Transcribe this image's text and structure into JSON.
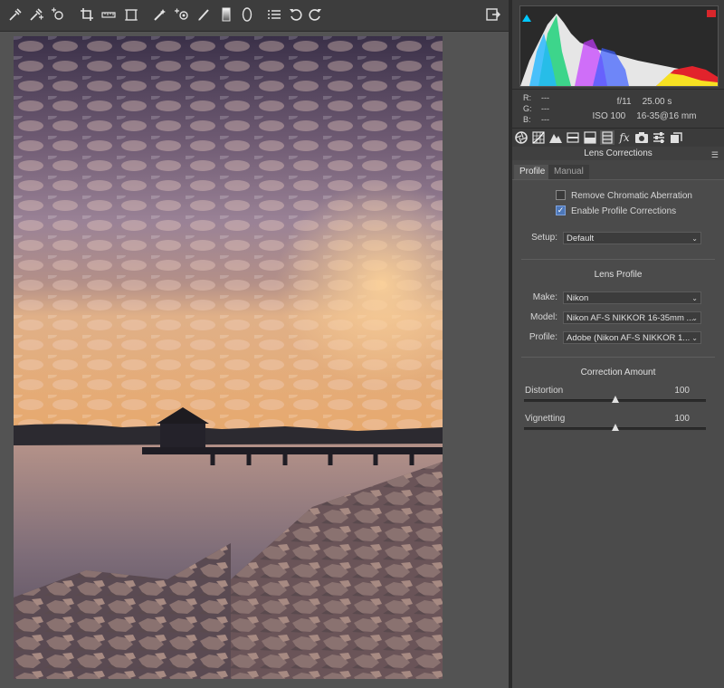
{
  "toolbar": {
    "tools": [
      {
        "icon": "white-balance-eyedropper-icon"
      },
      {
        "icon": "color-sampler-icon"
      },
      {
        "icon": "targeted-adjustment-icon"
      },
      {
        "icon": "crop-icon"
      },
      {
        "icon": "straighten-icon"
      },
      {
        "icon": "transform-icon"
      },
      {
        "icon": "spot-removal-icon"
      },
      {
        "icon": "red-eye-icon"
      },
      {
        "icon": "adjustment-brush-icon"
      },
      {
        "icon": "graduated-filter-icon"
      },
      {
        "icon": "radial-filter-icon"
      },
      {
        "icon": "preferences-list-icon"
      },
      {
        "icon": "rotate-left-icon"
      },
      {
        "icon": "rotate-right-icon"
      },
      {
        "icon": "open-object-icon"
      }
    ]
  },
  "readout": {
    "r_label": "R:",
    "r_value": "---",
    "g_label": "G:",
    "g_value": "---",
    "b_label": "B:",
    "b_value": "---",
    "aperture": "f/11",
    "shutter": "25.00 s",
    "iso": "ISO 100",
    "lens": "16-35@16 mm"
  },
  "panel_tabs": [
    {
      "icon": "basic-aperture-icon"
    },
    {
      "icon": "tone-curve-grid-icon"
    },
    {
      "icon": "detail-mountain-icon"
    },
    {
      "icon": "hsl-icon"
    },
    {
      "icon": "split-toning-icon"
    },
    {
      "icon": "lens-corrections-icon"
    },
    {
      "icon": "effects-fx-icon"
    },
    {
      "icon": "camera-calibration-icon"
    },
    {
      "icon": "presets-sliders-icon"
    },
    {
      "icon": "snapshots-icon"
    }
  ],
  "panel": {
    "title": "Lens Corrections",
    "tab_profile": "Profile",
    "tab_manual": "Manual",
    "remove_ca_label": "Remove Chromatic Aberration",
    "remove_ca_checked": false,
    "enable_profile_label": "Enable Profile Corrections",
    "enable_profile_checked": true,
    "setup_label": "Setup:",
    "setup_value": "Default",
    "lens_profile_heading": "Lens Profile",
    "make_label": "Make:",
    "make_value": "Nikon",
    "model_label": "Model:",
    "model_value": "Nikon AF-S NIKKOR 16-35mm ...",
    "profile_label": "Profile:",
    "profile_value": "Adobe (Nikon AF-S NIKKOR 1...",
    "correction_heading": "Correction Amount",
    "distortion_label": "Distortion",
    "distortion_value": "100",
    "vignetting_label": "Vignetting",
    "vignetting_value": "100",
    "distortion_level": 0.5,
    "vignetting_level": 0.5
  },
  "colors": {
    "accent_checkbox": "#4d77b8",
    "clip_warning_shadow": "#00c8ff",
    "clip_warning_highlight": "#d8262b"
  }
}
